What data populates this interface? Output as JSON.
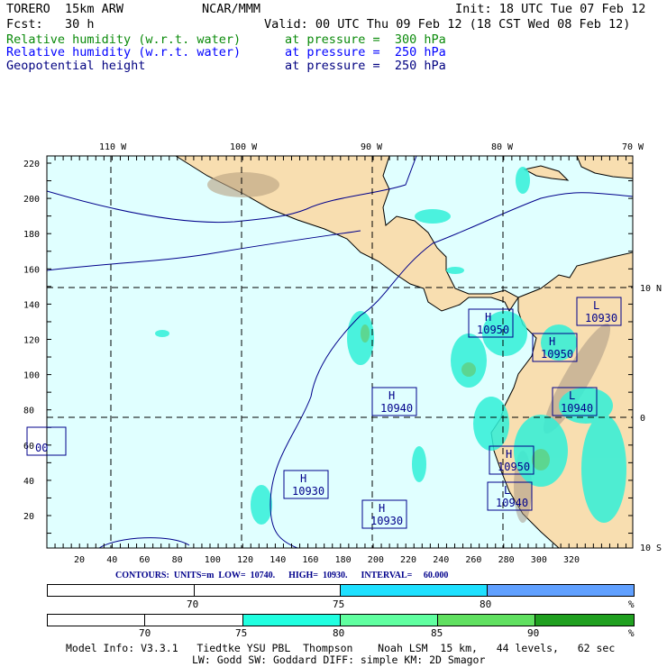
{
  "header": {
    "model": "TORERO  15km ARW",
    "org": "NCAR/MMM",
    "init": "Init: 18 UTC Tue 07 Feb 12",
    "fcst": "Fcst:   30 h",
    "valid": "Valid: 00 UTC Thu 09 Feb 12 (18 CST Wed 08 Feb 12)"
  },
  "fields": [
    {
      "name": "Relative humidity (w.r.t. water)",
      "level": "at pressure =  300 hPa",
      "color": "#0a8a0a"
    },
    {
      "name": "Relative humidity (w.r.t. water)",
      "level": "at pressure =  250 hPa",
      "color": "#0000ff"
    },
    {
      "name": "Geopotential height",
      "level": "at pressure =  250 hPa",
      "color": "#000080"
    }
  ],
  "map": {
    "top_lon_labels": [
      "110 W",
      "100 W",
      "90 W",
      "80 W",
      "70 W"
    ],
    "right_lat_labels": [
      "10 N",
      "0",
      "10 S"
    ],
    "x_ticks": [
      "20",
      "40",
      "60",
      "80",
      "100",
      "120",
      "140",
      "160",
      "180",
      "200",
      "220",
      "240",
      "260",
      "280",
      "300",
      "320"
    ],
    "y_ticks": [
      "220",
      "200",
      "180",
      "160",
      "140",
      "120",
      "100",
      "80",
      "60",
      "40",
      "20"
    ],
    "centers": [
      {
        "type": "H",
        "value": "10940"
      },
      {
        "type": "H",
        "value": "10930"
      },
      {
        "type": "H",
        "value": "10930"
      },
      {
        "type": "H",
        "value": "10950"
      },
      {
        "type": "H",
        "value": "10950"
      },
      {
        "type": "L",
        "value": "10930"
      },
      {
        "type": "L",
        "value": "10940"
      },
      {
        "type": "H",
        "value": "10950"
      },
      {
        "type": "L",
        "value": "10940"
      },
      {
        "type": "",
        "value": "00"
      }
    ],
    "colors": {
      "ocean": "#e0ffff",
      "land": "#f8deb0",
      "contour": "#00008b"
    }
  },
  "contours_info": "CONTOURS:  UNITS=m  LOW=  10740.      HIGH=  10930.      INTERVAL=     60.000",
  "bar1": {
    "labels": [
      "70",
      "75",
      "80",
      "%"
    ],
    "colors": [
      "#ffffff",
      "#ffffff",
      "#1ee0ff",
      "#60a0ff"
    ]
  },
  "bar2": {
    "labels": [
      "70",
      "75",
      "80",
      "85",
      "90",
      "%"
    ],
    "colors": [
      "#ffffff",
      "#ffffff",
      "#20ffe0",
      "#60ffa0",
      "#60e060",
      "#20a020"
    ]
  },
  "footer": {
    "line1": "Model Info: V3.3.1   Tiedtke YSU PBL  Thompson    Noah LSM  15 km,   44 levels,   62 sec",
    "line2": "LW: Godd SW: Goddard DIFF: simple KM: 2D Smagor"
  }
}
